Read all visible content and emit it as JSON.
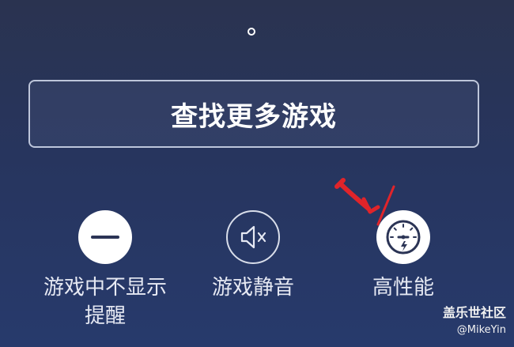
{
  "main": {
    "find_more_label": "查找更多游戏"
  },
  "options": [
    {
      "icon": "minus-circle-icon",
      "label": "游戏中不显示\n提醒"
    },
    {
      "icon": "mute-speaker-icon",
      "label": "游戏静音"
    },
    {
      "icon": "speedometer-icon",
      "label": "高性能"
    }
  ],
  "watermark": {
    "title": "盖乐世社区",
    "user": "@MikeYin"
  },
  "colors": {
    "background_top": "#2a3350",
    "background_bottom": "#273a6c",
    "annotation": "#e0242a"
  }
}
